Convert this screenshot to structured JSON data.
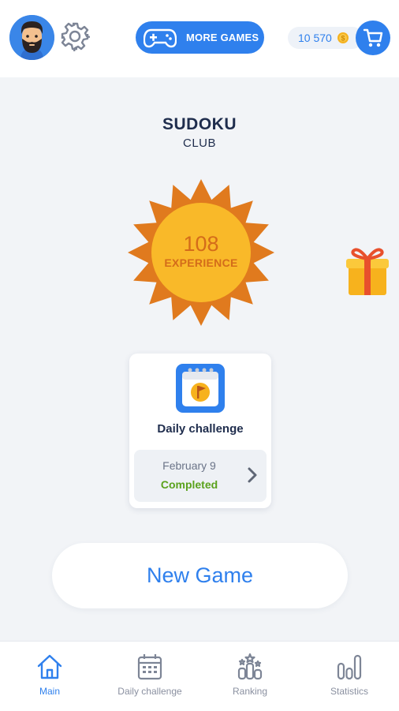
{
  "header": {
    "more_games_label": "MORE GAMES",
    "coins": "10 570",
    "icons": [
      "avatar",
      "gear-icon",
      "gamepad-icon",
      "coin-icon",
      "cart-icon"
    ]
  },
  "title": {
    "main": "SUDOKU",
    "sub": "CLUB"
  },
  "experience": {
    "value": "108",
    "label": "EXPERIENCE"
  },
  "daily_card": {
    "title": "Daily challenge",
    "date": "February 9",
    "status": "Completed"
  },
  "new_game_label": "New Game",
  "nav": {
    "items": [
      {
        "label": "Main",
        "icon": "home-icon",
        "active": true
      },
      {
        "label": "Daily challenge",
        "icon": "calendar-icon",
        "active": false
      },
      {
        "label": "Ranking",
        "icon": "ranking-icon",
        "active": false
      },
      {
        "label": "Statistics",
        "icon": "statistics-icon",
        "active": false
      }
    ]
  },
  "colors": {
    "accent": "#2f80ed",
    "sun_outer": "#e07a1e",
    "sun_inner": "#f9b929",
    "completed": "#5aa21c",
    "background": "#f2f4f7"
  }
}
